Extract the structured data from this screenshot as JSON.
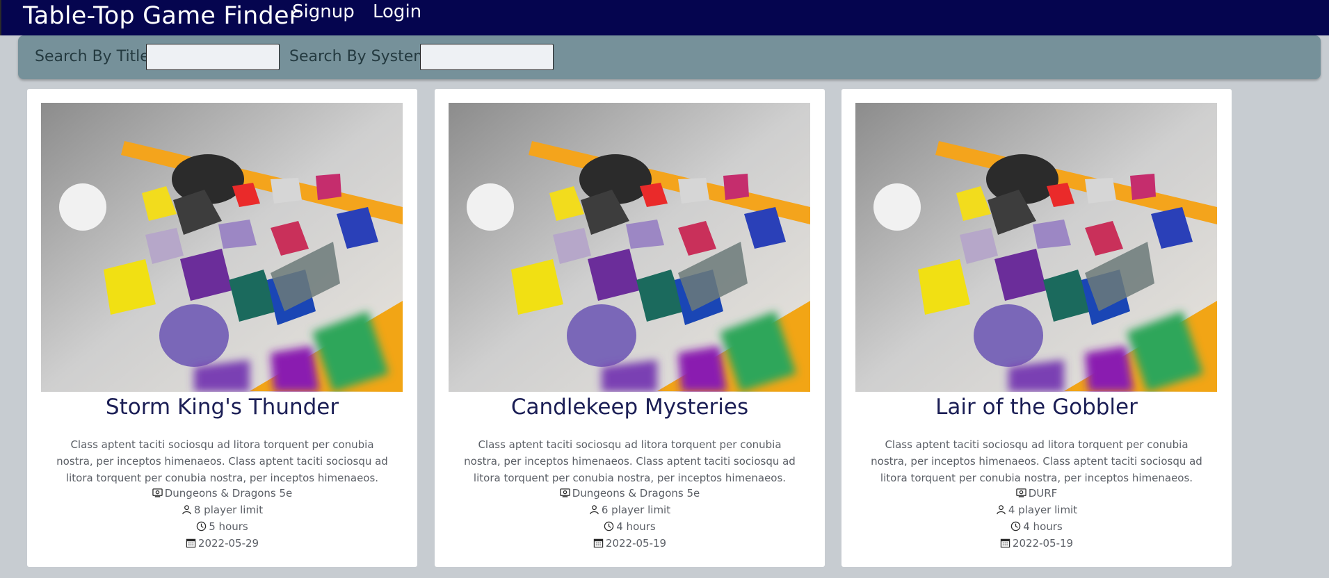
{
  "nav": {
    "brand": "Table-Top Game Finder",
    "signup": "Signup",
    "login": "Login"
  },
  "search": {
    "title_label": "Search By Title",
    "title_value": "",
    "system_label": "Search By System",
    "system_value": ""
  },
  "cards": [
    {
      "title": "Storm King's Thunder",
      "description": "Class aptent taciti sociosqu ad litora torquent per conubia nostra, per inceptos himenaeos. Class aptent taciti sociosqu ad litora torquent per conubia nostra, per inceptos himenaeos.",
      "system": "Dungeons & Dragons 5e",
      "players": "8 player limit",
      "duration": "5 hours",
      "date": "2022-05-29"
    },
    {
      "title": "Candlekeep Mysteries",
      "description": "Class aptent taciti sociosqu ad litora torquent per conubia nostra, per inceptos himenaeos. Class aptent taciti sociosqu ad litora torquent per conubia nostra, per inceptos himenaeos.",
      "system": "Dungeons & Dragons 5e",
      "players": "6 player limit",
      "duration": "4 hours",
      "date": "2022-05-19"
    },
    {
      "title": "Lair of the Gobbler",
      "description": "Class aptent taciti sociosqu ad litora torquent per conubia nostra, per inceptos himenaeos. Class aptent taciti sociosqu ad litora torquent per conubia nostra, per inceptos himenaeos.",
      "system": "DURF",
      "players": "4 player limit",
      "duration": "4 hours",
      "date": "2022-05-19"
    }
  ],
  "colors": {
    "navbar": "#05054f",
    "searchbar": "#76919a",
    "page_background": "#c7ccd1",
    "card_title": "#1b1e55"
  },
  "icons": {
    "system": "gear-monitor-icon",
    "players": "person-icon",
    "duration": "clock-icon",
    "date": "calendar-icon"
  }
}
